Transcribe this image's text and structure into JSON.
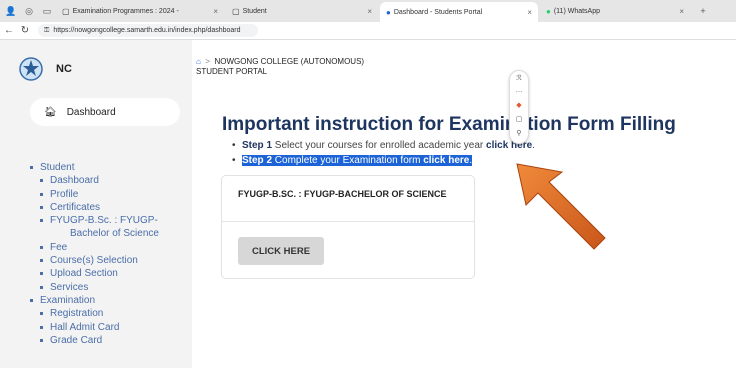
{
  "browser": {
    "tabs": [
      {
        "label": "Examination Programmes : 2024 -",
        "active": false
      },
      {
        "label": "Student",
        "active": false
      },
      {
        "label": "Dashboard - Students Portal",
        "active": true
      },
      {
        "label": "(11) WhatsApp",
        "active": false
      }
    ],
    "url": "https://nowgongcollege.samarth.edu.in/index.php/dashboard"
  },
  "sidebar": {
    "brand": "NC",
    "dashboard_label": "Dashboard",
    "items": [
      {
        "label": "Student",
        "level": 0
      },
      {
        "label": "Dashboard",
        "level": 1
      },
      {
        "label": "Profile",
        "level": 1
      },
      {
        "label": "Certificates",
        "level": 1
      },
      {
        "label": "FYUGP-B.Sc. : FYUGP-",
        "level": 1
      },
      {
        "label": "Bachelor of Science",
        "level": 2
      },
      {
        "label": "Fee",
        "level": 1
      },
      {
        "label": "Course(s) Selection",
        "level": 1
      },
      {
        "label": "Upload Section",
        "level": 1
      },
      {
        "label": "Services",
        "level": 1
      },
      {
        "label": "Examination",
        "level": 0
      },
      {
        "label": "Registration",
        "level": 1
      },
      {
        "label": "Hall Admit Card",
        "level": 1
      },
      {
        "label": "Grade Card",
        "level": 1
      }
    ]
  },
  "breadcrumb": {
    "college": "NOWGONG COLLEGE (AUTONOMOUS)",
    "portal": "STUDENT PORTAL"
  },
  "main": {
    "title": "Important instruction for Examination Form Filling",
    "step1_label": "Step 1",
    "step1_text": " Select your courses for enrolled academic year ",
    "step1_link": "click here",
    "step2_label": "Step 2",
    "step2_text": " Complete your Examination form ",
    "step2_link": "click here",
    "card_title": "FYUGP-B.SC. : FYUGP-BACHELOR OF SCIENCE",
    "card_button": "CLICK HERE"
  },
  "colors": {
    "accent": "#1b63d6",
    "heading": "#1e3560",
    "menu": "#4b6ea9",
    "arrow": "#e06d1f"
  }
}
